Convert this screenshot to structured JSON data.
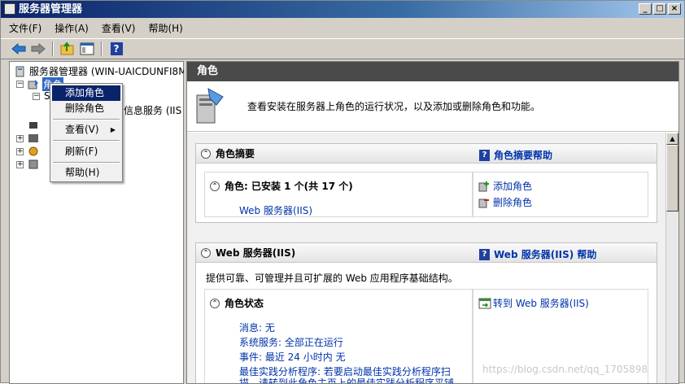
{
  "window": {
    "title": "服务器管理器",
    "controls": [
      "_",
      "□",
      "×"
    ]
  },
  "menubar": [
    "文件(F)",
    "操作(A)",
    "查看(V)",
    "帮助(H)"
  ],
  "tree": {
    "root": "服务器管理器 (WIN-UAICDUNFI8M)",
    "roles": "角色",
    "iis_label": "信息服务 (IIS",
    "iis_trunc": "S)"
  },
  "context_menu": {
    "add": "添加角色",
    "remove": "删除角色",
    "view": "查看(V)",
    "refresh": "刷新(F)",
    "help": "帮助(H)"
  },
  "right": {
    "header": "角色",
    "intro": "查看安装在服务器上角色的运行状况，以及添加或删除角色和功能。",
    "summary": {
      "title": "角色摘要",
      "help_link": "角色摘要帮助",
      "roles_line": "角色: 已安装 1 个(共 17 个)",
      "installed_role": "Web 服务器(IIS)",
      "add_role": "添加角色",
      "remove_role": "删除角色"
    },
    "web": {
      "title": "Web 服务器(IIS)",
      "help_link": "Web 服务器(IIS) 帮助",
      "description": "提供可靠、可管理并且可扩展的 Web 应用程序基础结构。",
      "status_title": "角色状态",
      "goto_link": "转到 Web 服务器(IIS)",
      "messages": "消息: 无",
      "services": "系统服务: 全部正在运行",
      "events": "事件: 最近 24 小时内 无",
      "bpa1": "最佳实践分析程序: 若要启动最佳实践分析程序扫",
      "bpa2": "描，请转到此角色主页上的最佳实践分析程序平铺"
    }
  },
  "watermark": "https://blog.csdn.net/qq_1705898"
}
